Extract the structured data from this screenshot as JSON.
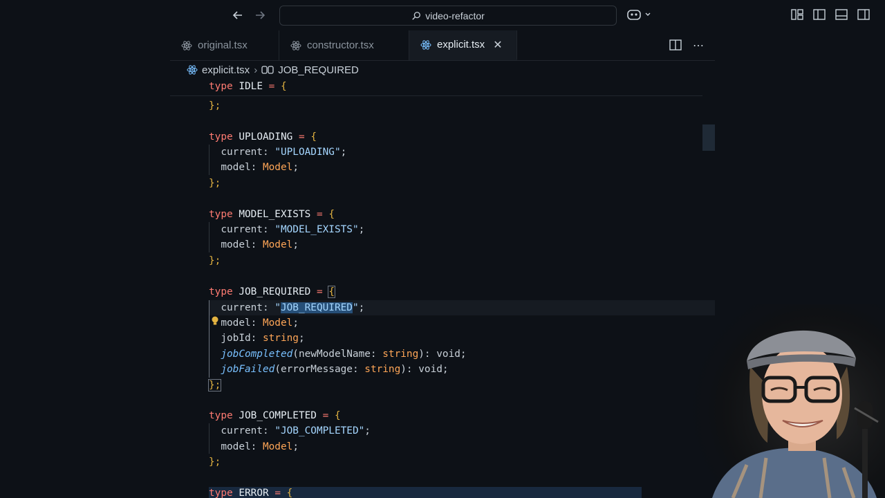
{
  "titlebar": {
    "search_text": "video-refactor"
  },
  "tabs": [
    {
      "label": "original.tsx",
      "active": false
    },
    {
      "label": "constructor.tsx",
      "active": false
    },
    {
      "label": "explicit.tsx",
      "active": true
    }
  ],
  "breadcrumb": {
    "file": "explicit.tsx",
    "symbol": "JOB_REQUIRED"
  },
  "code": {
    "sticky": [
      "type",
      "IDLE",
      "=",
      "{"
    ],
    "l1": "};",
    "uploading": {
      "kw": "type",
      "name": "UPLOADING",
      "eq": "=",
      "open": "{",
      "current_key": "current:",
      "current_val": "\"UPLOADING\"",
      "semi": ";",
      "model_key": "model:",
      "model_type": "Model",
      "close": "};"
    },
    "model_exists": {
      "kw": "type",
      "name": "MODEL_EXISTS",
      "eq": "=",
      "open": "{",
      "current_key": "current:",
      "current_val": "\"MODEL_EXISTS\"",
      "semi": ";",
      "model_key": "model:",
      "model_type": "Model",
      "close": "};"
    },
    "job_required": {
      "kw": "type",
      "name": "JOB_REQUIRED",
      "eq": "=",
      "open": "{",
      "current_key": "current:",
      "quote_open": "\"",
      "current_sel": "JOB_REQUIRED",
      "quote_close": "\"",
      "semi": ";",
      "model_key": "model:",
      "model_type": "Model",
      "jobid_key": "jobId:",
      "jobid_type": "string",
      "completed_fn": "jobCompleted",
      "completed_param": "(newModelName:",
      "completed_param_type": "string",
      "completed_ret": "): void;",
      "failed_fn": "jobFailed",
      "failed_param": "(errorMessage:",
      "failed_param_type": "string",
      "failed_ret": "): void;",
      "close": "};"
    },
    "job_completed": {
      "kw": "type",
      "name": "JOB_COMPLETED",
      "eq": "=",
      "open": "{",
      "current_key": "current:",
      "current_val": "\"JOB_COMPLETED\"",
      "semi": ";",
      "model_key": "model:",
      "model_type": "Model",
      "close": "};"
    },
    "error": {
      "kw": "type",
      "name": "ERROR",
      "eq": "=",
      "open": "{"
    }
  },
  "colors": {
    "keyword": "#ff7b72",
    "string": "#a5d6ff",
    "class": "#ffa657",
    "function": "#79c0ff",
    "bracket": "#e3b341"
  }
}
